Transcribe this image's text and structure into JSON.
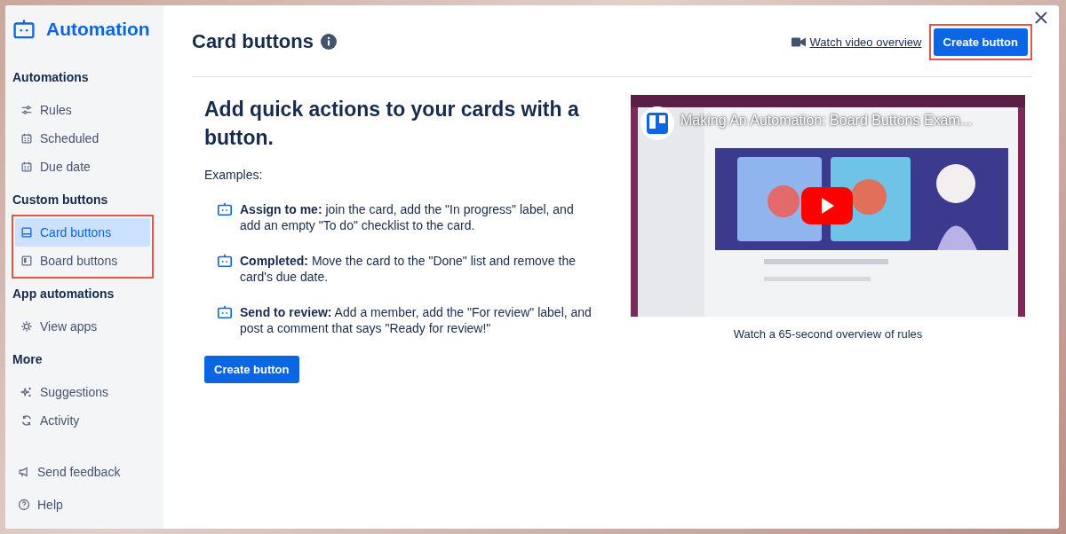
{
  "sidebar": {
    "title": "Automation",
    "sections": [
      {
        "heading": "Automations",
        "highlighted": false,
        "items": [
          {
            "label": "Rules",
            "kind": "sliders",
            "selected": false
          },
          {
            "label": "Scheduled",
            "kind": "calendar",
            "selected": false
          },
          {
            "label": "Due date",
            "kind": "calendar",
            "selected": false
          }
        ]
      },
      {
        "heading": "Custom buttons",
        "highlighted": true,
        "items": [
          {
            "label": "Card buttons",
            "kind": "card",
            "selected": true
          },
          {
            "label": "Board buttons",
            "kind": "board",
            "selected": false
          }
        ]
      },
      {
        "heading": "App automations",
        "highlighted": false,
        "items": [
          {
            "label": "View apps",
            "kind": "gear",
            "selected": false
          }
        ]
      },
      {
        "heading": "More",
        "highlighted": false,
        "items": [
          {
            "label": "Suggestions",
            "kind": "sparkle",
            "selected": false
          },
          {
            "label": "Activity",
            "kind": "refresh",
            "selected": false
          }
        ]
      }
    ],
    "footer": [
      {
        "label": "Send feedback",
        "kind": "megaphone"
      },
      {
        "label": "Help",
        "kind": "help"
      }
    ]
  },
  "header": {
    "title": "Card buttons",
    "video_link": "Watch video overview",
    "create_button": {
      "label": "Create button",
      "highlighted": true
    }
  },
  "intro": {
    "heading": "Add quick actions to your cards with a button.",
    "examples_label": "Examples:",
    "examples": [
      {
        "text": "**Assign to me:** join the card, add the \"In progress\" label, and add an empty \"To do\" checklist to the card."
      },
      {
        "text": "**Completed:** Move the card to the \"Done\" list and remove the card's due date."
      },
      {
        "text": "**Send to review:** Add a member, add the \"For review\" label, and post a comment that says \"Ready for review!\""
      }
    ],
    "button": "Create button"
  },
  "video": {
    "kind": "picture",
    "title": "Making An Automation: Board Buttons Exam...",
    "caption": "Watch a 65-second overview of rules"
  }
}
